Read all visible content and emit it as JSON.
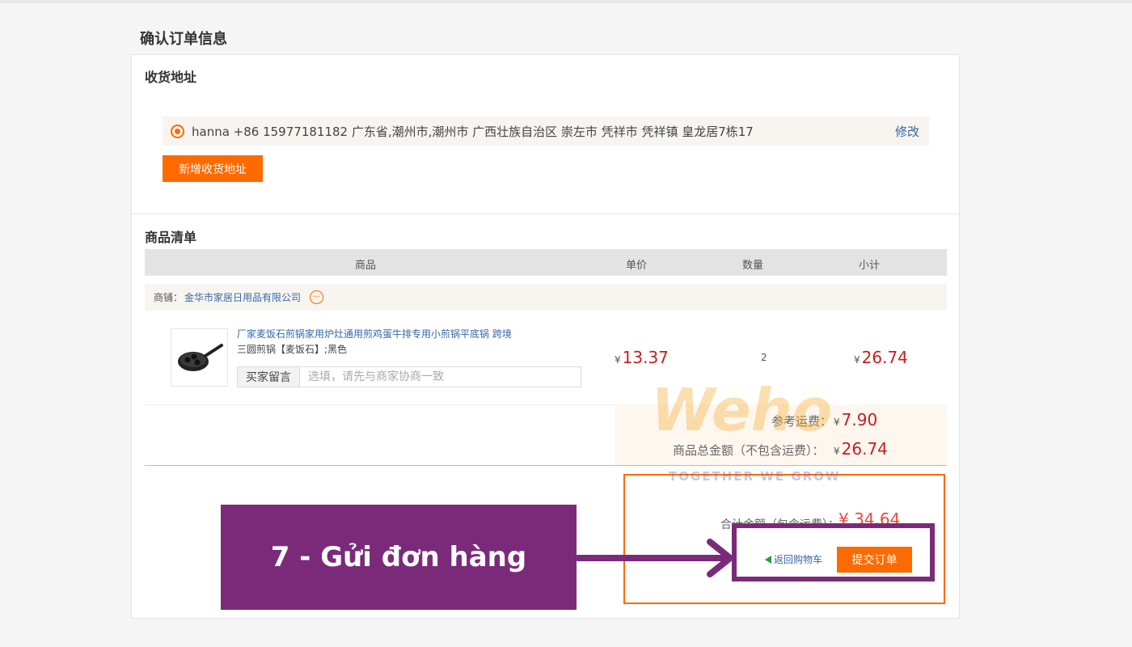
{
  "page": {
    "title": "确认订单信息"
  },
  "address": {
    "section_title": "收货地址",
    "entry": "hanna +86 15977181182 广东省,潮州市,潮州市 广西壮族自治区 崇左市 凭祥市 凭祥镇 皇龙居7栋17",
    "edit_label": "修改",
    "add_button": "新增收货地址"
  },
  "goods": {
    "section_title": "商品清单",
    "columns": [
      "商品",
      "单价",
      "数量",
      "小计"
    ],
    "shop_prefix": "商铺：",
    "shop_name": "金华市家居日用品有限公司",
    "item": {
      "title": "厂家麦饭石煎锅家用炉灶通用煎鸡蛋牛排专用小煎锅平底锅 跨境",
      "spec": "三圆煎锅【麦饭石】;黑色",
      "unit_price": "13.37",
      "quantity": "2",
      "subtotal": "26.74"
    },
    "note_label": "买家留言",
    "note_placeholder": "选填，请先与商家协商一致"
  },
  "summary": {
    "currency": "¥",
    "shipping_label": "参考运费：",
    "shipping_value": "7.90",
    "goods_total_label": "商品总金额（不包含运费）：",
    "goods_total_value": "26.74",
    "grand_total_label": "合计金额（包含运费）：",
    "grand_total_value": "¥ 34.64",
    "back_label": "返回购物车",
    "submit_label": "提交订单"
  },
  "annotation": {
    "callout": "7 - Gửi đơn hàng"
  },
  "watermark": {
    "logo": "Weho",
    "tagline": "TOGETHER WE GROW"
  },
  "colors": {
    "accent": "#ff6a00",
    "price": "#c81e1e",
    "link": "#3366aa",
    "callout": "#7b2a7a"
  }
}
